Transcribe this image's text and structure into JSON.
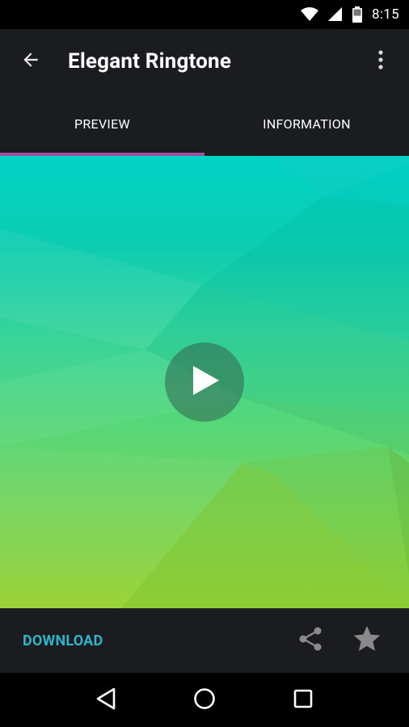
{
  "status_bar": {
    "time": "8:15",
    "icons": [
      "wifi-icon",
      "cell-signal-icon",
      "battery-icon"
    ]
  },
  "app_bar": {
    "title": "Elegant Ringtone",
    "back_icon": "arrow-back-icon",
    "overflow_icon": "more-vert-icon"
  },
  "tabs": [
    {
      "label": "PREVIEW",
      "selected": true
    },
    {
      "label": "INFORMATION",
      "selected": false
    }
  ],
  "preview": {
    "play_icon": "play-icon"
  },
  "actions": {
    "download_label": "DOWNLOAD",
    "share_icon": "share-icon",
    "favorite_icon": "star-icon"
  },
  "nav_bar": {
    "icons": [
      "back-triangle-icon",
      "home-circle-icon",
      "recents-square-icon"
    ]
  },
  "colors": {
    "bar_background": "#1a1c20",
    "accent_indicator": "#9e4fa0",
    "download_text": "#30b4c8",
    "gradient_top": "#00d2c6",
    "gradient_bottom": "#98d231"
  }
}
